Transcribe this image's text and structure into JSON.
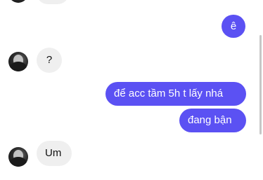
{
  "messages": [
    {
      "id": "m1",
      "direction": "outgoing",
      "text": "ê"
    },
    {
      "id": "m2",
      "direction": "incoming",
      "text": "?"
    },
    {
      "id": "m3",
      "direction": "outgoing",
      "text": "để acc tầm 5h t lấy nhá"
    },
    {
      "id": "m4",
      "direction": "outgoing",
      "text": "đang bận"
    },
    {
      "id": "m5",
      "direction": "incoming",
      "text": "Um"
    }
  ],
  "colors": {
    "outgoing_bubble": "#5b51f3",
    "incoming_bubble": "#efefef",
    "background": "#ffffff"
  }
}
